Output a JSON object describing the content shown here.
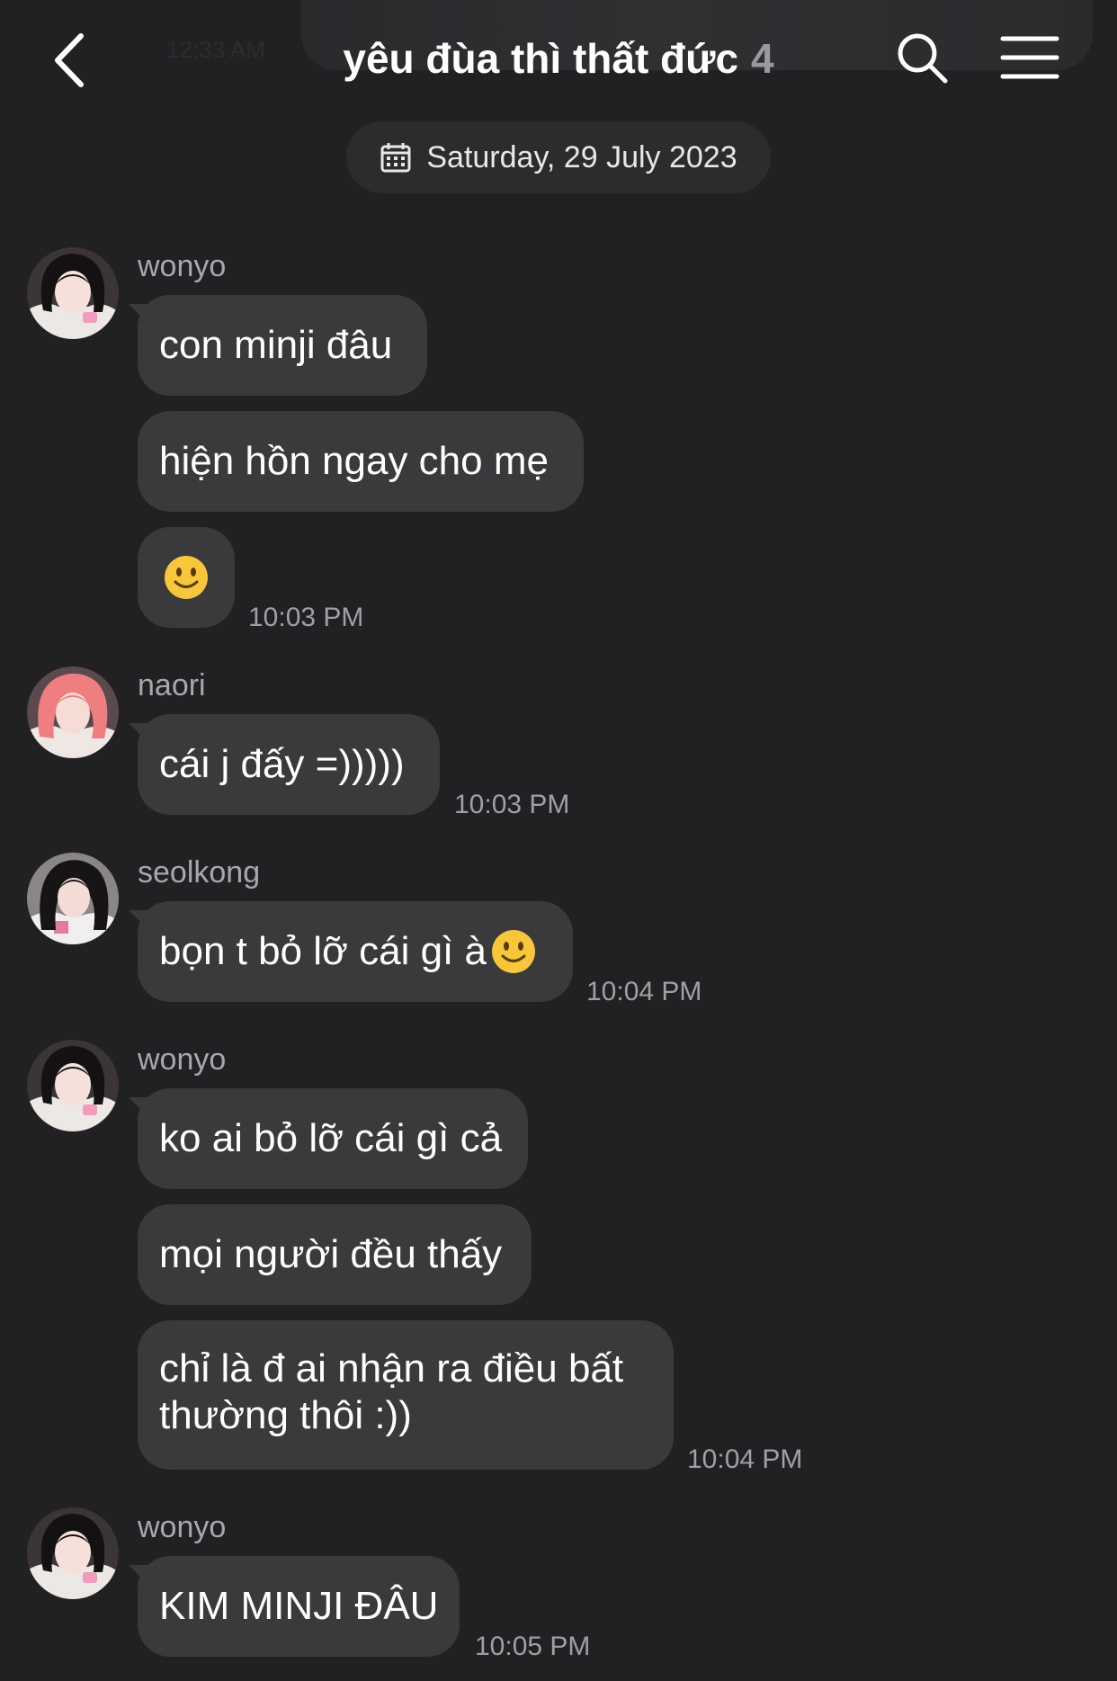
{
  "header": {
    "faded_time": "12:33 AM",
    "title": "yêu đùa thì thất đức",
    "member_count": "4"
  },
  "date_label": "Saturday, 29 July 2023",
  "messages": [
    {
      "sender": "wonyo",
      "texts": [
        "con minji đâu",
        "hiện hồn ngay cho mẹ",
        "🙂"
      ],
      "time": "10:03 PM"
    },
    {
      "sender": "naori",
      "texts": [
        "cái j đấy =)))))"
      ],
      "time": "10:03 PM"
    },
    {
      "sender": "seolkong",
      "texts": [
        "bọn t bỏ lỡ cái gì à"
      ],
      "time": "10:04 PM"
    },
    {
      "sender": "wonyo",
      "texts": [
        "ko ai bỏ lỡ cái gì cả",
        "mọi người đều thấy",
        "chỉ là đ ai nhận ra điều bất thường thôi :))"
      ],
      "time": "10:04 PM"
    },
    {
      "sender": "wonyo",
      "texts": [
        "KIM MINJI ĐÂU"
      ],
      "time": "10:05 PM"
    }
  ],
  "icons": {
    "back": "chevron-left-icon",
    "search": "search-icon",
    "menu": "hamburger-menu-icon",
    "date": "calendar-icon",
    "emoji": "slightly-smiling-face-emoji"
  },
  "colors": {
    "background": "#212124",
    "bubble": "#3a3a3d",
    "date_pill": "#2c2c2f",
    "secondary_text": "#a8a8ac"
  }
}
